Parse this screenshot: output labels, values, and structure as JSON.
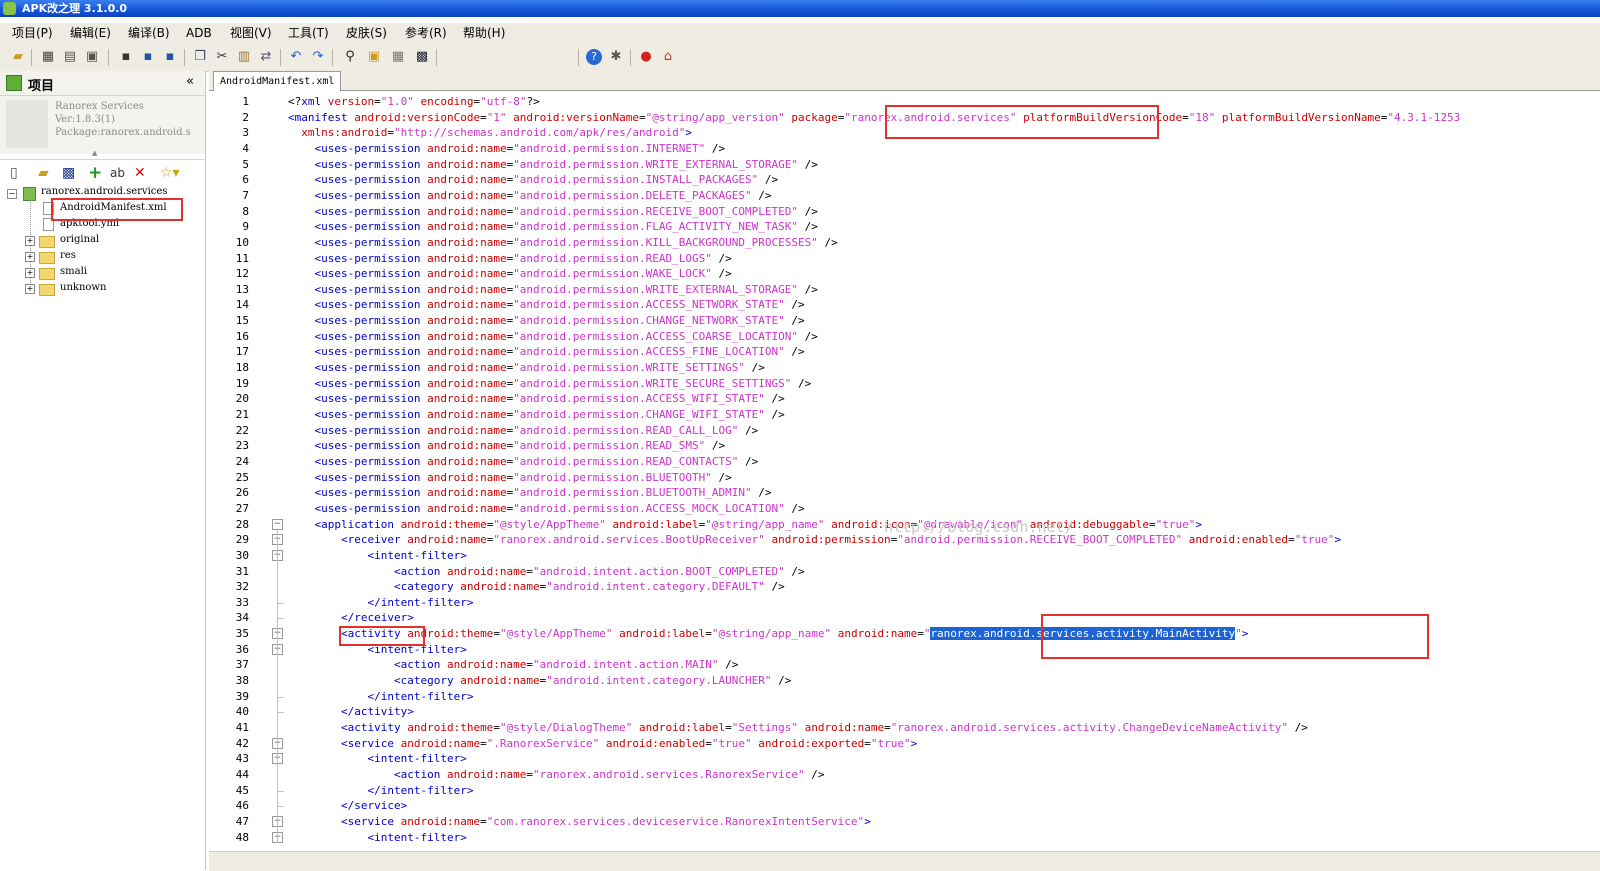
{
  "window": {
    "title": "APK改之理 3.1.0.0"
  },
  "menu": [
    "项目(P)",
    "编辑(E)",
    "编译(B)",
    "ADB",
    "视图(V)",
    "工具(T)",
    "皮肤(S)",
    "参考(R)",
    "帮助(H)"
  ],
  "toolbar": {
    "encoding": "gb2312"
  },
  "project_panel": {
    "title": "项目",
    "collapse_glyph": "«",
    "info": [
      "Ranorex Services",
      "Ver:1.8.3(1)",
      "Package:ranorex.android.s"
    ]
  },
  "tree": {
    "root": "ranorex.android.services",
    "files": [
      "AndroidManifest.xml",
      "apktool.yml"
    ],
    "folders": [
      "original",
      "res",
      "smali",
      "unknown"
    ]
  },
  "editor": {
    "tab": "AndroidManifest.xml",
    "watermark": "http://blog.csdn.net/",
    "lines": [
      [
        [
          "p",
          "<?"
        ],
        [
          "t",
          "xml"
        ],
        [
          "a",
          " version"
        ],
        [
          "p",
          "="
        ],
        [
          "v",
          "\"1.0\""
        ],
        [
          "a",
          " encoding"
        ],
        [
          "p",
          "="
        ],
        [
          "v",
          "\"utf-8\""
        ],
        [
          "p",
          "?>"
        ]
      ],
      [
        [
          "t",
          "<manifest"
        ],
        [
          "a",
          " android:versionCode"
        ],
        [
          "p",
          "="
        ],
        [
          "v",
          "\"1\""
        ],
        [
          "a",
          " android:versionName"
        ],
        [
          "p",
          "="
        ],
        [
          "v",
          "\"@string/app_version\""
        ],
        [
          "p",
          " "
        ],
        [
          "a",
          "package"
        ],
        [
          "p",
          "="
        ],
        [
          "v",
          "\"ranorex.android.services\""
        ],
        [
          "p",
          " "
        ],
        [
          "a",
          "platformBuildVersionCode"
        ],
        [
          "p",
          "="
        ],
        [
          "v",
          "\"18\""
        ],
        [
          "p",
          " "
        ],
        [
          "a",
          "platformBuildVersionName"
        ],
        [
          "p",
          "="
        ],
        [
          "v",
          "\"4.3.1-1253"
        ]
      ],
      [
        [
          "p",
          "  "
        ],
        [
          "a",
          "xmlns:android"
        ],
        [
          "p",
          "="
        ],
        [
          "v",
          "\"http://schemas.android.com/apk/res/android\""
        ],
        [
          "t",
          ">"
        ]
      ],
      [
        [
          "p",
          "    "
        ],
        [
          "t",
          "<uses-permission"
        ],
        [
          "a",
          " android:name"
        ],
        [
          "p",
          "="
        ],
        [
          "v",
          "\"android.permission.INTERNET\""
        ],
        [
          "p",
          " />"
        ]
      ],
      [
        [
          "p",
          "    "
        ],
        [
          "t",
          "<uses-permission"
        ],
        [
          "a",
          " android:name"
        ],
        [
          "p",
          "="
        ],
        [
          "v",
          "\"android.permission.WRITE_EXTERNAL_STORAGE\""
        ],
        [
          "p",
          " />"
        ]
      ],
      [
        [
          "p",
          "    "
        ],
        [
          "t",
          "<uses-permission"
        ],
        [
          "a",
          " android:name"
        ],
        [
          "p",
          "="
        ],
        [
          "v",
          "\"android.permission.INSTALL_PACKAGES\""
        ],
        [
          "p",
          " />"
        ]
      ],
      [
        [
          "p",
          "    "
        ],
        [
          "t",
          "<uses-permission"
        ],
        [
          "a",
          " android:name"
        ],
        [
          "p",
          "="
        ],
        [
          "v",
          "\"android.permission.DELETE_PACKAGES\""
        ],
        [
          "p",
          " />"
        ]
      ],
      [
        [
          "p",
          "    "
        ],
        [
          "t",
          "<uses-permission"
        ],
        [
          "a",
          " android:name"
        ],
        [
          "p",
          "="
        ],
        [
          "v",
          "\"android.permission.RECEIVE_BOOT_COMPLETED\""
        ],
        [
          "p",
          " />"
        ]
      ],
      [
        [
          "p",
          "    "
        ],
        [
          "t",
          "<uses-permission"
        ],
        [
          "a",
          " android:name"
        ],
        [
          "p",
          "="
        ],
        [
          "v",
          "\"android.permission.FLAG_ACTIVITY_NEW_TASK\""
        ],
        [
          "p",
          " />"
        ]
      ],
      [
        [
          "p",
          "    "
        ],
        [
          "t",
          "<uses-permission"
        ],
        [
          "a",
          " android:name"
        ],
        [
          "p",
          "="
        ],
        [
          "v",
          "\"android.permission.KILL_BACKGROUND_PROCESSES\""
        ],
        [
          "p",
          " />"
        ]
      ],
      [
        [
          "p",
          "    "
        ],
        [
          "t",
          "<uses-permission"
        ],
        [
          "a",
          " android:name"
        ],
        [
          "p",
          "="
        ],
        [
          "v",
          "\"android.permission.READ_LOGS\""
        ],
        [
          "p",
          " />"
        ]
      ],
      [
        [
          "p",
          "    "
        ],
        [
          "t",
          "<uses-permission"
        ],
        [
          "a",
          " android:name"
        ],
        [
          "p",
          "="
        ],
        [
          "v",
          "\"android.permission.WAKE_LOCK\""
        ],
        [
          "p",
          " />"
        ]
      ],
      [
        [
          "p",
          "    "
        ],
        [
          "t",
          "<uses-permission"
        ],
        [
          "a",
          " android:name"
        ],
        [
          "p",
          "="
        ],
        [
          "v",
          "\"android.permission.WRITE_EXTERNAL_STORAGE\""
        ],
        [
          "p",
          " />"
        ]
      ],
      [
        [
          "p",
          "    "
        ],
        [
          "t",
          "<uses-permission"
        ],
        [
          "a",
          " android:name"
        ],
        [
          "p",
          "="
        ],
        [
          "v",
          "\"android.permission.ACCESS_NETWORK_STATE\""
        ],
        [
          "p",
          " />"
        ]
      ],
      [
        [
          "p",
          "    "
        ],
        [
          "t",
          "<uses-permission"
        ],
        [
          "a",
          " android:name"
        ],
        [
          "p",
          "="
        ],
        [
          "v",
          "\"android.permission.CHANGE_NETWORK_STATE\""
        ],
        [
          "p",
          " />"
        ]
      ],
      [
        [
          "p",
          "    "
        ],
        [
          "t",
          "<uses-permission"
        ],
        [
          "a",
          " android:name"
        ],
        [
          "p",
          "="
        ],
        [
          "v",
          "\"android.permission.ACCESS_COARSE_LOCATION\""
        ],
        [
          "p",
          " />"
        ]
      ],
      [
        [
          "p",
          "    "
        ],
        [
          "t",
          "<uses-permission"
        ],
        [
          "a",
          " android:name"
        ],
        [
          "p",
          "="
        ],
        [
          "v",
          "\"android.permission.ACCESS_FINE_LOCATION\""
        ],
        [
          "p",
          " />"
        ]
      ],
      [
        [
          "p",
          "    "
        ],
        [
          "t",
          "<uses-permission"
        ],
        [
          "a",
          " android:name"
        ],
        [
          "p",
          "="
        ],
        [
          "v",
          "\"android.permission.WRITE_SETTINGS\""
        ],
        [
          "p",
          " />"
        ]
      ],
      [
        [
          "p",
          "    "
        ],
        [
          "t",
          "<uses-permission"
        ],
        [
          "a",
          " android:name"
        ],
        [
          "p",
          "="
        ],
        [
          "v",
          "\"android.permission.WRITE_SECURE_SETTINGS\""
        ],
        [
          "p",
          " />"
        ]
      ],
      [
        [
          "p",
          "    "
        ],
        [
          "t",
          "<uses-permission"
        ],
        [
          "a",
          " android:name"
        ],
        [
          "p",
          "="
        ],
        [
          "v",
          "\"android.permission.ACCESS_WIFI_STATE\""
        ],
        [
          "p",
          " />"
        ]
      ],
      [
        [
          "p",
          "    "
        ],
        [
          "t",
          "<uses-permission"
        ],
        [
          "a",
          " android:name"
        ],
        [
          "p",
          "="
        ],
        [
          "v",
          "\"android.permission.CHANGE_WIFI_STATE\""
        ],
        [
          "p",
          " />"
        ]
      ],
      [
        [
          "p",
          "    "
        ],
        [
          "t",
          "<uses-permission"
        ],
        [
          "a",
          " android:name"
        ],
        [
          "p",
          "="
        ],
        [
          "v",
          "\"android.permission.READ_CALL_LOG\""
        ],
        [
          "p",
          " />"
        ]
      ],
      [
        [
          "p",
          "    "
        ],
        [
          "t",
          "<uses-permission"
        ],
        [
          "a",
          " android:name"
        ],
        [
          "p",
          "="
        ],
        [
          "v",
          "\"android.permission.READ_SMS\""
        ],
        [
          "p",
          " />"
        ]
      ],
      [
        [
          "p",
          "    "
        ],
        [
          "t",
          "<uses-permission"
        ],
        [
          "a",
          " android:name"
        ],
        [
          "p",
          "="
        ],
        [
          "v",
          "\"android.permission.READ_CONTACTS\""
        ],
        [
          "p",
          " />"
        ]
      ],
      [
        [
          "p",
          "    "
        ],
        [
          "t",
          "<uses-permission"
        ],
        [
          "a",
          " android:name"
        ],
        [
          "p",
          "="
        ],
        [
          "v",
          "\"android.permission.BLUETOOTH\""
        ],
        [
          "p",
          " />"
        ]
      ],
      [
        [
          "p",
          "    "
        ],
        [
          "t",
          "<uses-permission"
        ],
        [
          "a",
          " android:name"
        ],
        [
          "p",
          "="
        ],
        [
          "v",
          "\"android.permission.BLUETOOTH_ADMIN\""
        ],
        [
          "p",
          " />"
        ]
      ],
      [
        [
          "p",
          "    "
        ],
        [
          "t",
          "<uses-permission"
        ],
        [
          "a",
          " android:name"
        ],
        [
          "p",
          "="
        ],
        [
          "v",
          "\"android.permission.ACCESS_MOCK_LOCATION\""
        ],
        [
          "p",
          " />"
        ]
      ],
      [
        [
          "p",
          "    "
        ],
        [
          "t",
          "<application"
        ],
        [
          "a",
          " android:theme"
        ],
        [
          "p",
          "="
        ],
        [
          "v",
          "\"@style/AppTheme\""
        ],
        [
          "a",
          " android:label"
        ],
        [
          "p",
          "="
        ],
        [
          "v",
          "\"@string/app_name\""
        ],
        [
          "a",
          " android:icon"
        ],
        [
          "p",
          "="
        ],
        [
          "v",
          "\"@drawable/icon\""
        ],
        [
          "a",
          " android:debuggable"
        ],
        [
          "p",
          "="
        ],
        [
          "v",
          "\"true\""
        ],
        [
          "t",
          ">"
        ]
      ],
      [
        [
          "p",
          "        "
        ],
        [
          "t",
          "<receiver"
        ],
        [
          "a",
          " android:name"
        ],
        [
          "p",
          "="
        ],
        [
          "v",
          "\"ranorex.android.services.BootUpReceiver\""
        ],
        [
          "a",
          " android:permission"
        ],
        [
          "p",
          "="
        ],
        [
          "v",
          "\"android.permission.RECEIVE_BOOT_COMPLETED\""
        ],
        [
          "a",
          " android:enabled"
        ],
        [
          "p",
          "="
        ],
        [
          "v",
          "\"true\""
        ],
        [
          "t",
          ">"
        ]
      ],
      [
        [
          "p",
          "            "
        ],
        [
          "t",
          "<intent-filter>"
        ]
      ],
      [
        [
          "p",
          "                "
        ],
        [
          "t",
          "<action"
        ],
        [
          "a",
          " android:name"
        ],
        [
          "p",
          "="
        ],
        [
          "v",
          "\"android.intent.action.BOOT_COMPLETED\""
        ],
        [
          "p",
          " />"
        ]
      ],
      [
        [
          "p",
          "                "
        ],
        [
          "t",
          "<category"
        ],
        [
          "a",
          " android:name"
        ],
        [
          "p",
          "="
        ],
        [
          "v",
          "\"android.intent.category.DEFAULT\""
        ],
        [
          "p",
          " />"
        ]
      ],
      [
        [
          "p",
          "            "
        ],
        [
          "t",
          "</intent-filter>"
        ]
      ],
      [
        [
          "p",
          "        "
        ],
        [
          "t",
          "</receiver>"
        ]
      ],
      [
        [
          "p",
          "        "
        ],
        [
          "t",
          "<activity"
        ],
        [
          "a",
          " android:theme"
        ],
        [
          "p",
          "="
        ],
        [
          "v",
          "\"@style/AppTheme\""
        ],
        [
          "a",
          " android:label"
        ],
        [
          "p",
          "="
        ],
        [
          "v",
          "\"@string/app_name\""
        ],
        [
          "a",
          " android:name"
        ],
        [
          "p",
          "="
        ],
        [
          "v",
          "\""
        ],
        [
          "s",
          "ranorex.android.services.activity.MainActivity"
        ],
        [
          "v",
          "\""
        ],
        [
          "t",
          ">"
        ]
      ],
      [
        [
          "p",
          "            "
        ],
        [
          "t",
          "<intent-filter>"
        ]
      ],
      [
        [
          "p",
          "                "
        ],
        [
          "t",
          "<action"
        ],
        [
          "a",
          " android:name"
        ],
        [
          "p",
          "="
        ],
        [
          "v",
          "\"android.intent.action.MAIN\""
        ],
        [
          "p",
          " />"
        ]
      ],
      [
        [
          "p",
          "                "
        ],
        [
          "t",
          "<category"
        ],
        [
          "a",
          " android:name"
        ],
        [
          "p",
          "="
        ],
        [
          "v",
          "\"android.intent.category.LAUNCHER\""
        ],
        [
          "p",
          " />"
        ]
      ],
      [
        [
          "p",
          "            "
        ],
        [
          "t",
          "</intent-filter>"
        ]
      ],
      [
        [
          "p",
          "        "
        ],
        [
          "t",
          "</activity>"
        ]
      ],
      [
        [
          "p",
          "        "
        ],
        [
          "t",
          "<activity"
        ],
        [
          "a",
          " android:theme"
        ],
        [
          "p",
          "="
        ],
        [
          "v",
          "\"@style/DialogTheme\""
        ],
        [
          "a",
          " android:label"
        ],
        [
          "p",
          "="
        ],
        [
          "v",
          "\"Settings\""
        ],
        [
          "a",
          " android:name"
        ],
        [
          "p",
          "="
        ],
        [
          "v",
          "\"ranorex.android.services.activity.ChangeDeviceNameActivity\""
        ],
        [
          "p",
          " />"
        ]
      ],
      [
        [
          "p",
          "        "
        ],
        [
          "t",
          "<service"
        ],
        [
          "a",
          " android:name"
        ],
        [
          "p",
          "="
        ],
        [
          "v",
          "\".RanorexService\""
        ],
        [
          "a",
          " android:enabled"
        ],
        [
          "p",
          "="
        ],
        [
          "v",
          "\"true\""
        ],
        [
          "a",
          " android:exported"
        ],
        [
          "p",
          "="
        ],
        [
          "v",
          "\"true\""
        ],
        [
          "t",
          ">"
        ]
      ],
      [
        [
          "p",
          "            "
        ],
        [
          "t",
          "<intent-filter>"
        ]
      ],
      [
        [
          "p",
          "                "
        ],
        [
          "t",
          "<action"
        ],
        [
          "a",
          " android:name"
        ],
        [
          "p",
          "="
        ],
        [
          "v",
          "\"ranorex.android.services.RanorexService\""
        ],
        [
          "p",
          " />"
        ]
      ],
      [
        [
          "p",
          "            "
        ],
        [
          "t",
          "</intent-filter>"
        ]
      ],
      [
        [
          "p",
          "        "
        ],
        [
          "t",
          "</service>"
        ]
      ],
      [
        [
          "p",
          "        "
        ],
        [
          "t",
          "<service"
        ],
        [
          "a",
          " android:name"
        ],
        [
          "p",
          "="
        ],
        [
          "v",
          "\"com.ranorex.services.deviceservice.RanorexIntentService\""
        ],
        [
          "t",
          ">"
        ]
      ],
      [
        [
          "p",
          "            "
        ],
        [
          "t",
          "<intent-filter>"
        ]
      ]
    ]
  },
  "colors": {
    "tag": "#0000cc",
    "attribute": "#cc0000",
    "value": "#cc33cc",
    "highlight": "#e53030",
    "selection": "#1c64d6"
  }
}
